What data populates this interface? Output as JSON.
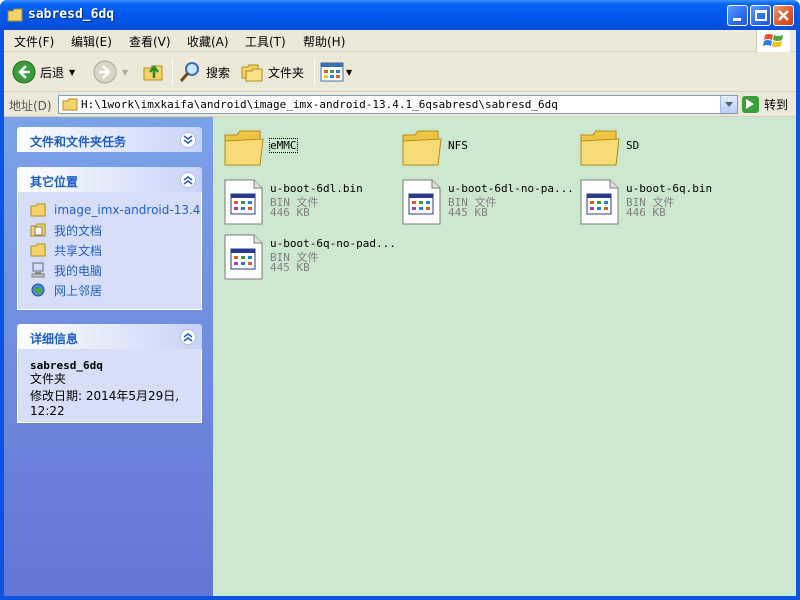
{
  "window": {
    "title": "sabresd_6dq",
    "accent": "#0054e3"
  },
  "menubar": {
    "items": [
      "文件(F)",
      "编辑(E)",
      "查看(V)",
      "收藏(A)",
      "工具(T)",
      "帮助(H)"
    ]
  },
  "toolbar": {
    "back_label": "后退",
    "search_label": "搜索",
    "folders_label": "文件夹"
  },
  "address": {
    "label": "地址(D)",
    "path": "H:\\1work\\imxkaifa\\android\\image_imx-android-13.4.1_6qsabresd\\sabresd_6dq",
    "go_label": "转到"
  },
  "tasks_panel": {
    "title": "文件和文件夹任务"
  },
  "places_panel": {
    "title": "其它位置",
    "items": [
      {
        "label": "image_imx-android-13.4",
        "icon": "folder-icon"
      },
      {
        "label": "我的文档",
        "icon": "my-documents-icon"
      },
      {
        "label": "共享文档",
        "icon": "shared-folder-icon"
      },
      {
        "label": "我的电脑",
        "icon": "my-computer-icon"
      },
      {
        "label": "网上邻居",
        "icon": "network-places-icon"
      }
    ]
  },
  "details_panel": {
    "title": "详细信息",
    "name": "sabresd_6dq",
    "type": "文件夹",
    "modified_line1": "修改日期: 2014年5月29日,",
    "modified_line2": "12:22"
  },
  "files": {
    "folders": [
      {
        "name": "eMMC"
      },
      {
        "name": "NFS"
      },
      {
        "name": "SD"
      }
    ],
    "bins": [
      {
        "name": "u-boot-6dl.bin",
        "type": "BIN 文件",
        "size": "446 KB"
      },
      {
        "name": "u-boot-6dl-no-pa...",
        "type": "BIN 文件",
        "size": "445 KB"
      },
      {
        "name": "u-boot-6q.bin",
        "type": "BIN 文件",
        "size": "446 KB"
      },
      {
        "name": "u-boot-6q-no-pad...",
        "type": "BIN 文件",
        "size": "445 KB"
      }
    ]
  }
}
